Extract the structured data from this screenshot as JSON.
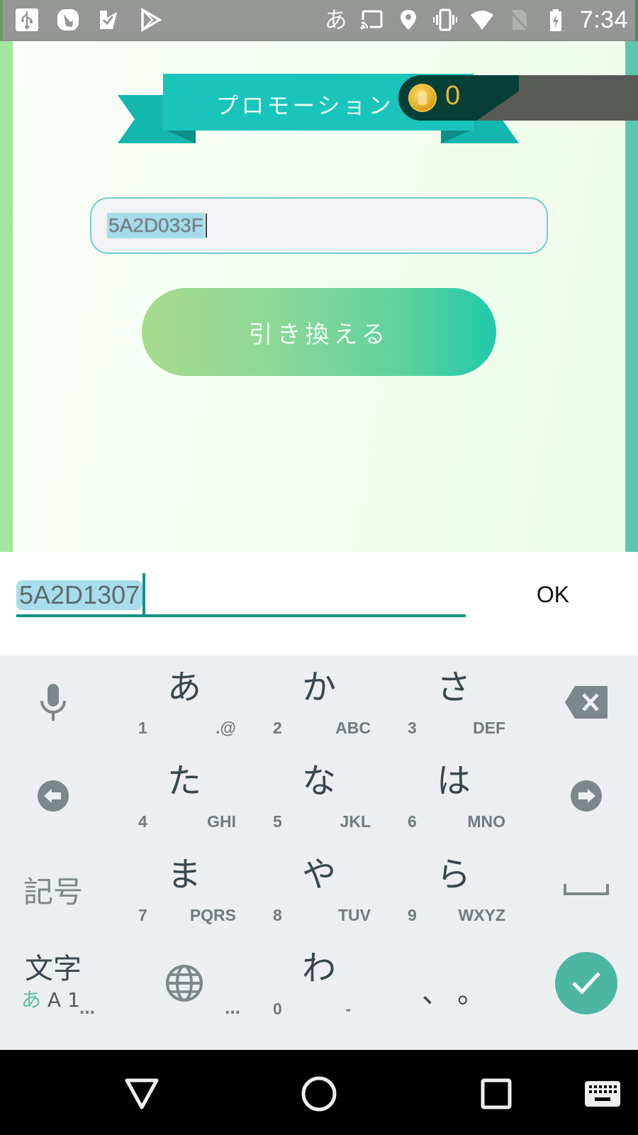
{
  "status_bar": {
    "left_icons": [
      "usb-icon",
      "app-notification-icon",
      "checkmark-app-icon",
      "play-store-icon"
    ],
    "ime_indicator": "あ",
    "right_icons": [
      "cast-icon",
      "location-icon",
      "vibrate-icon",
      "wifi-icon",
      "no-sim-icon",
      "battery-charging-icon"
    ],
    "time": "7:34"
  },
  "header": {
    "title": "プロモーション",
    "coin_count": "0"
  },
  "promo": {
    "input_value": "5A2D033F",
    "redeem_label": "引き換える"
  },
  "ime_edit": {
    "value": "5A2D1307",
    "ok_label": "OK"
  },
  "keyboard": {
    "rows": [
      [
        {
          "main": "あ",
          "num": "1",
          "sub": ".@"
        },
        {
          "main": "か",
          "num": "2",
          "sub": "ABC"
        },
        {
          "main": "さ",
          "num": "3",
          "sub": "DEF"
        }
      ],
      [
        {
          "main": "た",
          "num": "4",
          "sub": "GHI"
        },
        {
          "main": "な",
          "num": "5",
          "sub": "JKL"
        },
        {
          "main": "は",
          "num": "6",
          "sub": "MNO"
        }
      ],
      [
        {
          "main": "ま",
          "num": "7",
          "sub": "PQRS"
        },
        {
          "main": "や",
          "num": "8",
          "sub": "TUV"
        },
        {
          "main": "ら",
          "num": "9",
          "sub": "WXYZ"
        }
      ]
    ],
    "wa_key": {
      "main": "わ",
      "num": "0",
      "sub": "-"
    },
    "punct_key": "、。",
    "symbols_label": "記号",
    "mode_label": "文字",
    "mode_sub_kana": "あ",
    "mode_sub_alnum": "A 1",
    "more_indicator": "…",
    "left_icons": [
      "microphone-icon",
      "cursor-left-icon"
    ],
    "right_icons": [
      "backspace-icon",
      "cursor-right-icon",
      "space-icon",
      "enter-check-icon"
    ],
    "globe_icon": "globe-icon"
  },
  "nav_bar": {
    "buttons": [
      "back-icon",
      "home-icon",
      "recents-icon",
      "keyboard-switch-icon"
    ]
  },
  "colors": {
    "ribbon": "#19c4bb",
    "accent_teal": "#16908a",
    "enter_key": "#4db6a3",
    "coin_text": "#e8b73a",
    "button_gradient_start": "#a6da8c",
    "button_gradient_end": "#20c9a9"
  }
}
